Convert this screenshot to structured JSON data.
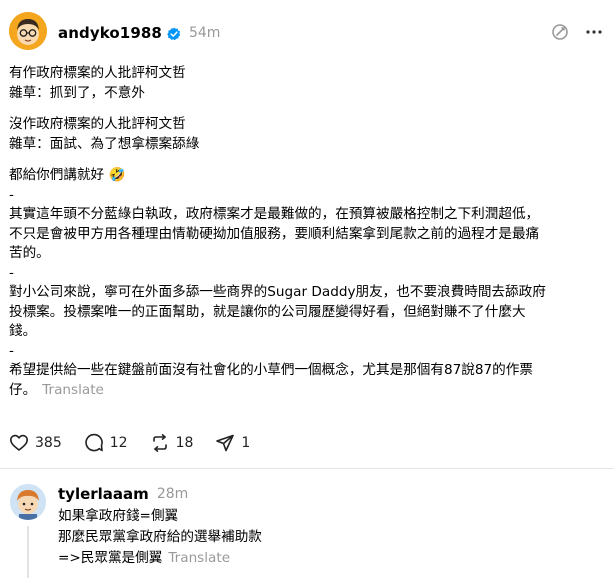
{
  "post": {
    "username": "andyko1988",
    "time": "54m",
    "paragraphs": [
      [
        "有作政府標案的人批評柯文哲",
        "雜草：抓到了，不意外"
      ],
      [
        "沒作政府標案的人批評柯文哲",
        "雜草：面試、為了想拿標案舔綠"
      ],
      [
        "都給你們講就好",
        "-",
        "其實這年頭不分藍綠白執政，政府標案才是最難做的，在預算被嚴格控制之下利潤超低，",
        "不只是會被甲方用各種理由情勒硬拗加值服務，要順利結案拿到尾款之前的過程才是最痛",
        "苦的。",
        "-",
        "對小公司來說，寧可在外面多舔一些商界的Sugar Daddy朋友，也不要浪費時間去舔政府",
        "投標案。投標案唯一的正面幫助，就是讓你的公司履歷變得好看，但絕對賺不了什麼大",
        "錢。",
        "-",
        "希望提供給一些在鍵盤前面沒有社會化的小草們一個概念，尤其是那個有87說87的作票",
        "仔。"
      ]
    ],
    "translate_label": "Translate",
    "emoji": "🤣"
  },
  "actions": {
    "likes": "385",
    "comments": "12",
    "reposts": "18",
    "shares": "1"
  },
  "reply": {
    "username": "tylerlaaam",
    "time": "28m",
    "lines": [
      "如果拿政府錢=側翼",
      "那麼民眾黨拿政府給的選舉補助款",
      "=>民眾黨是側翼"
    ],
    "translate_label": "Translate"
  },
  "icons": {
    "verified": "verified-badge-icon",
    "activity": "circle-slash-icon",
    "more": "more-horizontal-icon",
    "like": "heart-icon",
    "comment": "comment-bubble-icon",
    "repost": "repost-icon",
    "share": "send-icon"
  },
  "colors": {
    "verified_blue": "#0095f6",
    "meta_gray": "#999999",
    "divider": "#e6e6e6"
  }
}
